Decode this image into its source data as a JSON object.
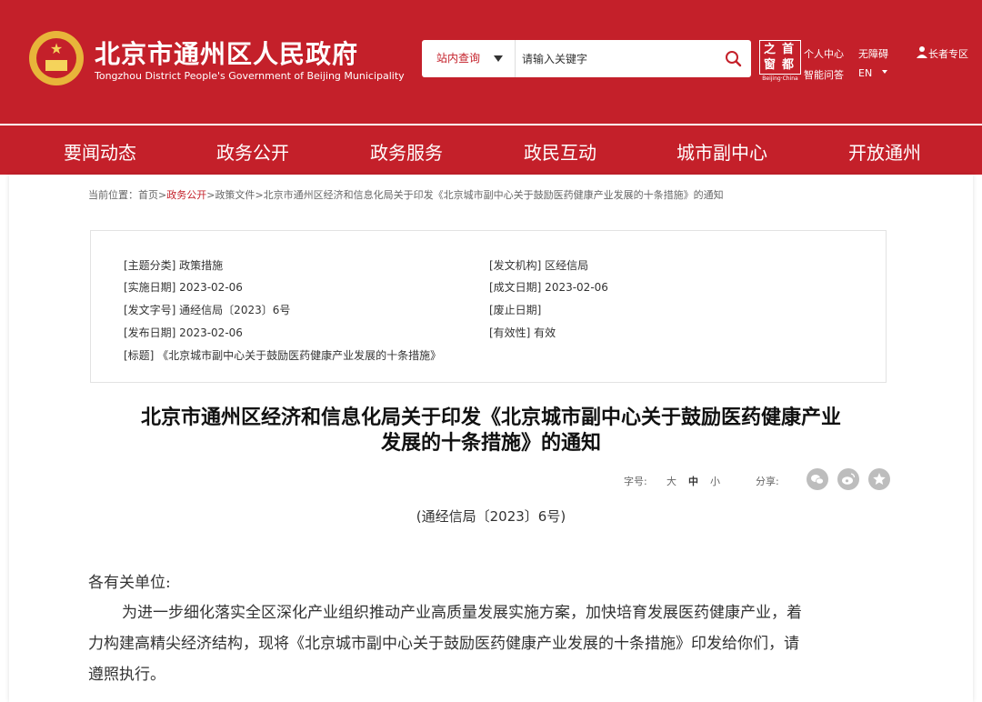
{
  "header": {
    "site_title": "北京市通州区人民政府",
    "site_subtitle": "Tongzhou District People's Government of Beijing Municipality",
    "search": {
      "scope": "站内查询",
      "placeholder": "请输入关键字"
    },
    "capital_logo": {
      "chars": [
        "之",
        "首",
        "窗",
        "都"
      ],
      "caption": "Beijing·China"
    },
    "links": {
      "personal_center": "个人中心",
      "accessibility": "无障碍",
      "elderly_zone": "长者专区",
      "smart_qa": "智能问答",
      "lang": "EN"
    },
    "brand_color": "#c4202a"
  },
  "nav": [
    "要闻动态",
    "政务公开",
    "政务服务",
    "政民互动",
    "城市副中心",
    "开放通州"
  ],
  "breadcrumb": {
    "prefix": "当前位置：",
    "home": "首页",
    "sep": ">",
    "level1": "政务公开",
    "level2": "政策文件",
    "current": "北京市通州区经济和信息化局关于印发《北京城市副中心关于鼓励医药健康产业发展的十条措施》的通知"
  },
  "meta": {
    "topic": "[主题分类] 政策措施",
    "issuer": "[发文机构] 区经信局",
    "effective_date": "[实施日期] 2023-02-06",
    "written_date": "[成文日期] 2023-02-06",
    "doc_number": "[发文字号] 通经信局〔2023〕6号",
    "repeal_date": "[废止日期]",
    "publish_date": "[发布日期] 2023-02-06",
    "validity": "[有效性] 有效",
    "title": "[标题] 《北京城市副中心关于鼓励医药健康产业发展的十条措施》"
  },
  "article": {
    "title_line1": "北京市通州区经济和信息化局关于印发《北京城市副中心关于鼓励医药健康产业",
    "title_line2": "发展的十条措施》的通知",
    "font_size_label": "字号:",
    "size_large": "大",
    "size_medium": "中",
    "size_small": "小",
    "share_label": "分享:",
    "doc_no": "(通经信局〔2023〕6号)",
    "salutation": "各有关单位:",
    "para_line1": "为进一步细化落实全区深化产业组织推动产业高质量发展实施方案，加快培育发展医药健康产业，着",
    "para_line2": "力构建高精尖经济结构，现将《北京城市副中心关于鼓励医药健康产业发展的十条措施》印发给你们，请",
    "para_line3": "遵照执行。"
  }
}
